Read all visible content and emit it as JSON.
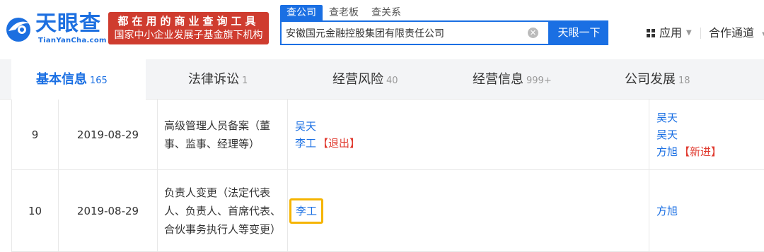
{
  "brand": {
    "name": "天眼查",
    "domain": "TianYanCha.com",
    "slogan_line1": "都在用的商业查询工具",
    "slogan_line2": "国家中小企业发展子基金旗下机构",
    "colors": {
      "primary": "#1a6fe3",
      "slogan_bg": "#cf3c2f"
    }
  },
  "search": {
    "tabs": [
      "查公司",
      "查老板",
      "查关系"
    ],
    "active_tab": "查公司",
    "value": "安徽国元金融控股集团有限责任公司",
    "button_label": "天眼一下",
    "clear_icon": "clear-icon"
  },
  "header_right": {
    "apps_label": "应用",
    "partner_label": "合作通道"
  },
  "nav": {
    "tabs": [
      {
        "label": "基本信息",
        "count": "165",
        "active": true
      },
      {
        "label": "法律诉讼",
        "count": "1",
        "active": false
      },
      {
        "label": "经营风险",
        "count": "40",
        "active": false
      },
      {
        "label": "经营信息",
        "count": "999+",
        "active": false
      },
      {
        "label": "公司发展",
        "count": "18",
        "active": false
      }
    ]
  },
  "rows": [
    {
      "index": "9",
      "date": "2019-08-29",
      "item": "高级管理人员备案（董事、监事、经理等）",
      "before": [
        {
          "name": "吴天",
          "tag": ""
        },
        {
          "name": "李工",
          "tag": "【退出】"
        }
      ],
      "after": [
        {
          "name": "吴天",
          "tag": ""
        },
        {
          "name": "吴天",
          "tag": ""
        },
        {
          "name": "方旭",
          "tag": "【新进】"
        }
      ]
    },
    {
      "index": "10",
      "date": "2019-08-29",
      "item": "负责人变更（法定代表人、负责人、首席代表、合伙事务执行人等变更）",
      "before": [
        {
          "name": "李工",
          "tag": "",
          "highlighted": true
        }
      ],
      "after": [
        {
          "name": "方旭",
          "tag": ""
        }
      ]
    }
  ]
}
